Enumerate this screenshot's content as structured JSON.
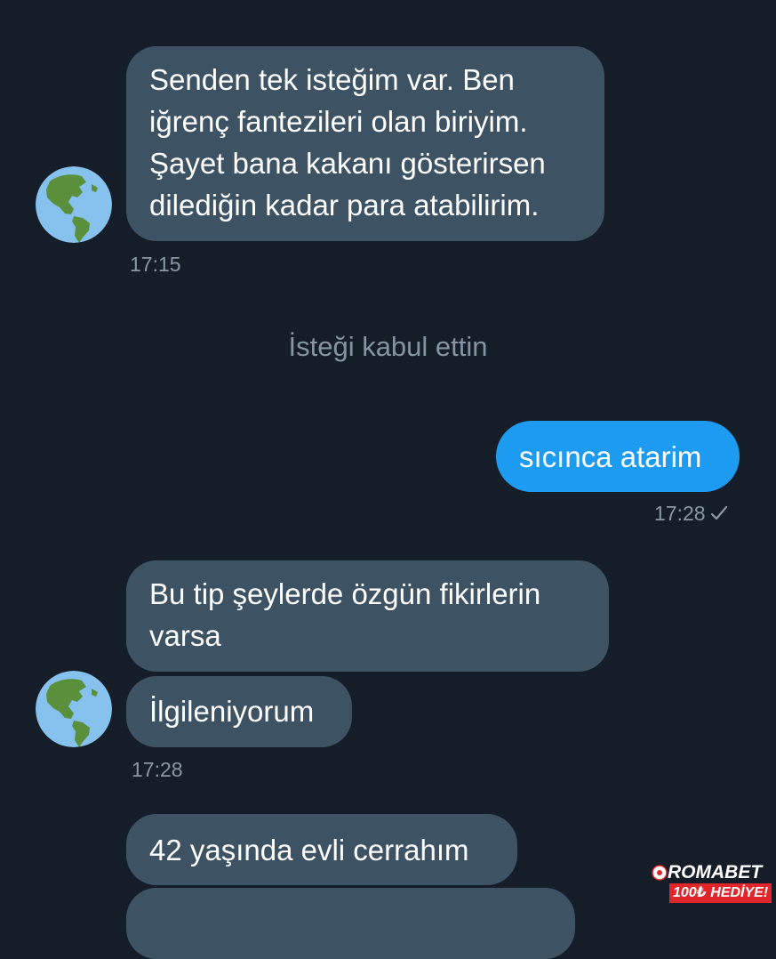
{
  "conversation": {
    "messages": [
      {
        "direction": "incoming",
        "lines": [
          "Senden tek isteğim var. Ben",
          "iğrenç fantezileri olan biriyim.",
          "Şayet bana kakanı gösterirsen",
          "dilediğin kadar para atabilirim."
        ],
        "time": "17:15"
      },
      {
        "direction": "system",
        "text": "İsteği kabul ettin"
      },
      {
        "direction": "outgoing",
        "lines": [
          "sıcınca atarim"
        ],
        "time": "17:28"
      },
      {
        "direction": "incoming",
        "lines": [
          "Bu tip şeylerde özgün fikirlerin",
          "varsa"
        ]
      },
      {
        "direction": "incoming",
        "lines": [
          "İlgileniyorum"
        ],
        "time": "17:28"
      },
      {
        "direction": "incoming",
        "lines": [
          "42 yaşında evli cerrahım"
        ]
      }
    ]
  },
  "avatar_icon": "globe-americas-icon",
  "status_icon": "sent-check-icon",
  "watermark": {
    "brand": "ROMABET",
    "offer": "100₺ HEDİYE!"
  },
  "colors": {
    "background": "#151d28",
    "incoming_bubble": "#3d5263",
    "outgoing_bubble": "#1d9bf0",
    "timestamp": "#8a98a6"
  }
}
